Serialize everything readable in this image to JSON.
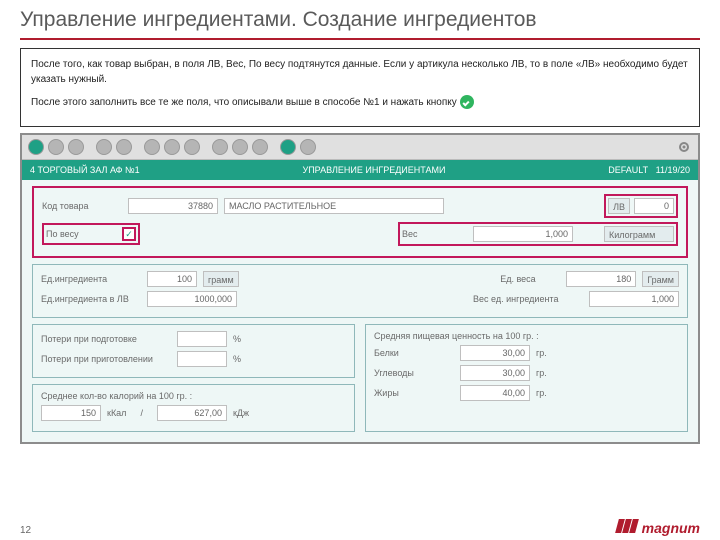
{
  "page": {
    "title": "Управление ингредиентами. Создание ингредиентов",
    "number": "12"
  },
  "instructions": {
    "p1": "После того, как товар выбран, в поля ЛВ, Вес, По весу подтянутся данные. Если у артикула несколько ЛВ, то в поле «ЛВ» необходимо будет указать нужный.",
    "p2_a": "После этого заполнить все те же поля, что описывали выше в способе №1  и нажать кнопку "
  },
  "header": {
    "location": "4 ТОРГОВЫЙ ЗАЛ АФ №1",
    "title": "УПРАВЛЕНИЕ ИНГРЕДИЕНТАМИ",
    "mode": "DEFAULT",
    "date": "11/19/20"
  },
  "f": {
    "code_lbl": "Код товара",
    "code_val": "37880",
    "name_val": "МАСЛО РАСТИТЕЛЬНОЕ",
    "lv_lbl": "ЛВ",
    "lv_val": "0",
    "byweight_lbl": "По весу",
    "byweight_chk": "✓",
    "weight_lbl": "Вес",
    "weight_val": "1,000",
    "weight_unit": "Килограмм",
    "u_ing_lbl": "Ед.ингредиента",
    "u_ing_val": "100",
    "u_ing_unit": "грамм",
    "u_wt_lbl": "Ед. веса",
    "u_wt_val": "180",
    "u_wt_unit": "Грамм",
    "u_ing_lv_lbl": "Ед.ингредиента в ЛВ",
    "u_ing_lv_val": "1000,000",
    "wt_u_ing_lbl": "Вес ед. ингредиента",
    "wt_u_ing_val": "1,000",
    "loss_prep_lbl": "Потери при подготовке",
    "loss_cook_lbl": "Потери при приготовлении",
    "pct": "%",
    "cal_lbl": "Среднее кол-во калорий на 100 гр. :",
    "cal_val": "150",
    "cal_unit": "кКал",
    "slash": "/",
    "kj_val": "627,00",
    "kj_unit": "кДж",
    "nut_lbl": "Средняя пищевая ценность на 100 гр. :",
    "prot_lbl": "Белки",
    "prot_val": "30,00",
    "carb_lbl": "Углеводы",
    "carb_val": "30,00",
    "fat_lbl": "Жиры",
    "fat_val": "40,00",
    "gr": "гр."
  },
  "logo": "magnum"
}
